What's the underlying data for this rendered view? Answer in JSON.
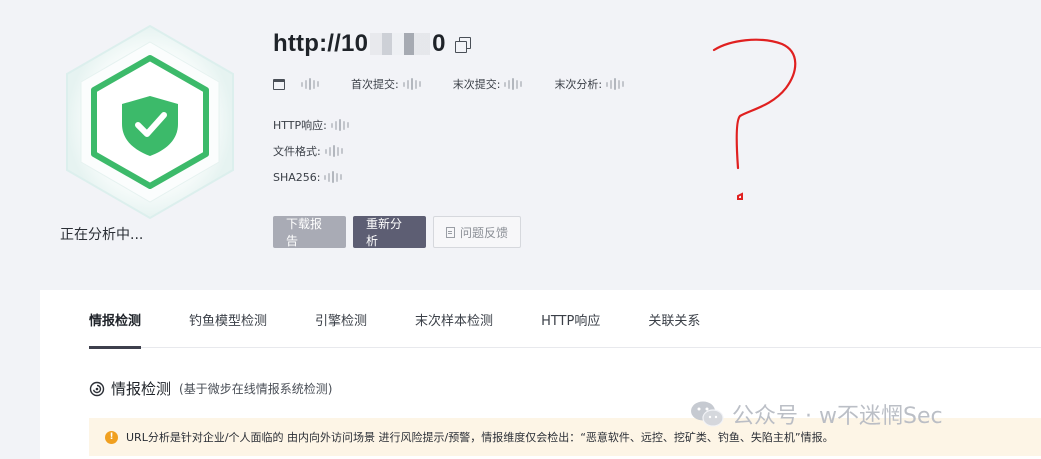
{
  "header": {
    "url_prefix": "http://10",
    "url_suffix": "0",
    "status": "正在分析中...",
    "meta": [
      {
        "label": "首次提交:"
      },
      {
        "label": "末次提交:"
      },
      {
        "label": "末次分析:"
      }
    ],
    "details": [
      {
        "label": "HTTP响应:"
      },
      {
        "label": "文件格式:"
      },
      {
        "label": "SHA256:"
      }
    ],
    "actions": {
      "download": "下载报告",
      "reanalyze": "重新分析",
      "feedback": "问题反馈"
    }
  },
  "tabs": [
    {
      "label": "情报检测",
      "active": true
    },
    {
      "label": "钓鱼模型检测"
    },
    {
      "label": "引擎检测"
    },
    {
      "label": "末次样本检测"
    },
    {
      "label": "HTTP响应"
    },
    {
      "label": "关联关系"
    }
  ],
  "section": {
    "title": "情报检测",
    "subtitle": "(基于微步在线情报系统检测)"
  },
  "notice": {
    "text": "URL分析是针对企业/个人面临的 由内向外访问场景 进行风险提示/预警，情报维度仅会检出：“恶意软件、远控、挖矿类、钓鱼、失陷主机”情报。"
  },
  "watermark": {
    "text": "公众号 · w不迷惘Sec"
  },
  "colors": {
    "shield_green": "#3cba6a",
    "primary_button": "#5d5e73",
    "disabled_button": "#a9abb5",
    "notice_bg": "#fdf5e6",
    "warning": "#f0a020",
    "annotation_red": "#e02020"
  },
  "icons": {
    "badge": "shield-check-icon",
    "copy": "copy-icon",
    "window": "window-icon",
    "feedback": "document-icon",
    "section": "spiral-icon",
    "notice": "warning-icon",
    "watermark": "wechat-icon"
  }
}
